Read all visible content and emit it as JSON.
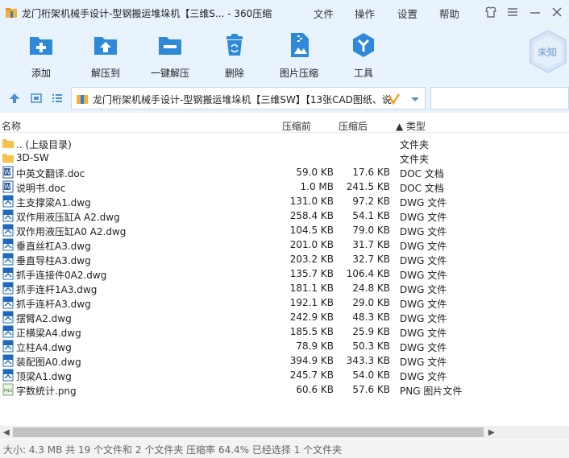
{
  "titlebar": {
    "title": "龙门桁架机械手设计-型钢搬运堆垛机【三维S... - 360压缩",
    "menu": [
      "文件",
      "操作",
      "设置",
      "帮助"
    ]
  },
  "toolbar": {
    "add": "添加",
    "extract": "解压到",
    "one_click": "一键解压",
    "delete": "删除",
    "image_compress": "图片压缩",
    "tools": "工具",
    "badge": "未知"
  },
  "address": {
    "path": "龙门桁架机械手设计-型钢搬运堆垛机【三维SW】【13张CAD图纸、说"
  },
  "columns": {
    "name": "名称",
    "size": "压缩前",
    "packed": "压缩后",
    "type": "▲ 类型"
  },
  "files": [
    {
      "icon": "folder-icon",
      "name": ".. (上级目录)",
      "size": "",
      "packed": "",
      "type": "文件夹"
    },
    {
      "icon": "folder-icon",
      "name": "3D-SW",
      "size": "",
      "packed": "",
      "type": "文件夹"
    },
    {
      "icon": "doc-icon",
      "name": "中英文翻译.doc",
      "size": "59.0 KB",
      "packed": "17.6 KB",
      "type": "DOC 文档"
    },
    {
      "icon": "doc-icon",
      "name": "说明书.doc",
      "size": "1.0 MB",
      "packed": "241.5 KB",
      "type": "DOC 文档"
    },
    {
      "icon": "dwg-icon",
      "name": "主支撑梁A1.dwg",
      "size": "131.0 KB",
      "packed": "97.2 KB",
      "type": "DWG 文件"
    },
    {
      "icon": "dwg-icon",
      "name": "双作用液压缸A A2.dwg",
      "size": "258.4 KB",
      "packed": "54.1 KB",
      "type": "DWG 文件"
    },
    {
      "icon": "dwg-icon",
      "name": "双作用液压缸A0 A2.dwg",
      "size": "104.5 KB",
      "packed": "79.0 KB",
      "type": "DWG 文件"
    },
    {
      "icon": "dwg-icon",
      "name": "垂直丝杠A3.dwg",
      "size": "201.0 KB",
      "packed": "31.7 KB",
      "type": "DWG 文件"
    },
    {
      "icon": "dwg-icon",
      "name": "垂直导柱A3.dwg",
      "size": "203.2 KB",
      "packed": "32.7 KB",
      "type": "DWG 文件"
    },
    {
      "icon": "dwg-icon",
      "name": "抓手连接件0A2.dwg",
      "size": "135.7 KB",
      "packed": "106.4 KB",
      "type": "DWG 文件"
    },
    {
      "icon": "dwg-icon",
      "name": "抓手连杆1A3.dwg",
      "size": "181.1 KB",
      "packed": "24.8 KB",
      "type": "DWG 文件"
    },
    {
      "icon": "dwg-icon",
      "name": "抓手连杆A3.dwg",
      "size": "192.1 KB",
      "packed": "29.0 KB",
      "type": "DWG 文件"
    },
    {
      "icon": "dwg-icon",
      "name": "摆臂A2.dwg",
      "size": "242.9 KB",
      "packed": "48.3 KB",
      "type": "DWG 文件"
    },
    {
      "icon": "dwg-icon",
      "name": "正横梁A4.dwg",
      "size": "185.5 KB",
      "packed": "25.9 KB",
      "type": "DWG 文件"
    },
    {
      "icon": "dwg-icon",
      "name": "立柱A4.dwg",
      "size": "78.9 KB",
      "packed": "50.3 KB",
      "type": "DWG 文件"
    },
    {
      "icon": "dwg-icon",
      "name": "装配图A0.dwg",
      "size": "394.9 KB",
      "packed": "343.3 KB",
      "type": "DWG 文件"
    },
    {
      "icon": "dwg-icon",
      "name": "顶梁A1.dwg",
      "size": "245.7 KB",
      "packed": "54.0 KB",
      "type": "DWG 文件"
    },
    {
      "icon": "png-icon",
      "name": "字数统计.png",
      "size": "60.6 KB",
      "packed": "57.6 KB",
      "type": "PNG 图片文件"
    }
  ],
  "status": "大小: 4.3 MB 共 19 个文件和 2 个文件夹 压缩率 64.4% 已经选择 1 个文件夹"
}
